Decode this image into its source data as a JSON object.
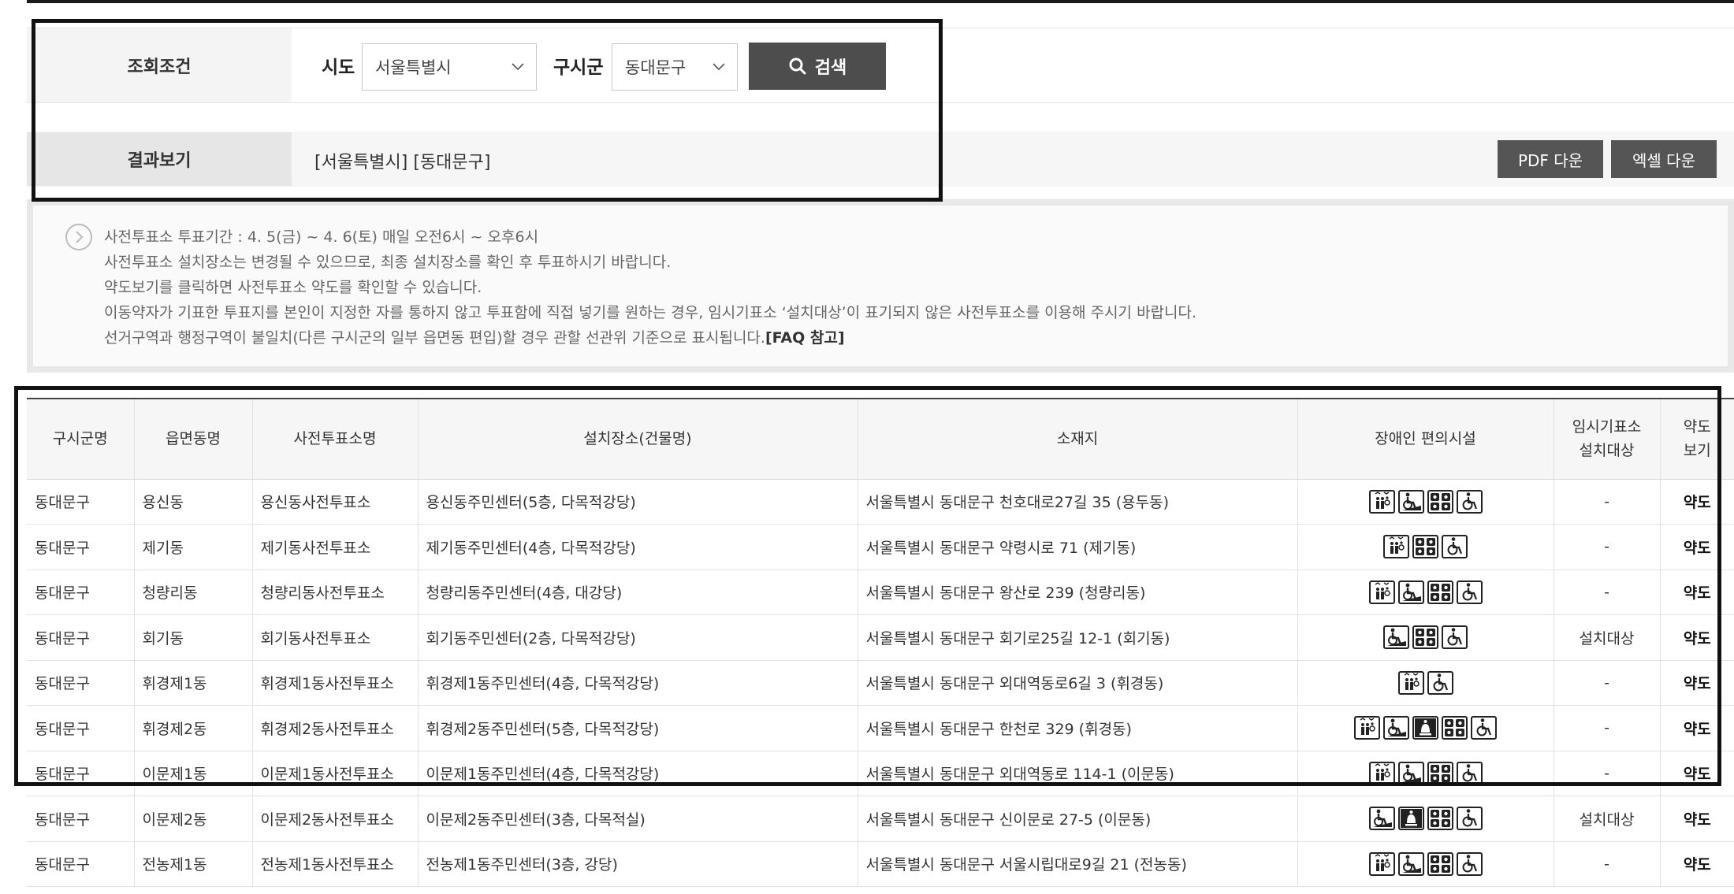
{
  "search": {
    "label": "조회조건",
    "sido_label": "시도",
    "sido_value": "서울특별시",
    "sigungu_label": "구시군",
    "sigungu_value": "동대문구",
    "button_label": "검색"
  },
  "result": {
    "label": "결과보기",
    "summary": "[서울특별시] [동대문구]",
    "pdf_label": "PDF 다운",
    "excel_label": "엑셀 다운"
  },
  "info": {
    "lines": [
      "사전투표소 투표기간 : 4. 5(금) ~ 4. 6(토) 매일 오전6시 ~ 오후6시",
      "사전투표소 설치장소는 변경될 수 있으므로, 최종 설치장소를 확인 후 투표하시기 바랍니다.",
      "약도보기를 클릭하면 사전투표소 약도를 확인할 수 있습니다.",
      "이동약자가 기표한 투표지를 본인이 지정한 자를 통하지 않고 투표함에 직접 넣기를 원하는 경우, 임시기표소 ‘설치대상’이 표기되지 않은 사전투표소를 이용해 주시기 바랍니다.",
      "선거구역과 행정구역이 불일치(다른 구시군의 일부 읍면동 편입)할 경우 관할 선관위 기준으로 표시됩니다."
    ],
    "faq_link": "[FAQ 참고]"
  },
  "table": {
    "headers": {
      "sigungu": "구시군명",
      "eupmyeondong": "읍면동명",
      "station": "사전투표소명",
      "place": "설치장소(건물명)",
      "address": "소재지",
      "facilities": "장애인 편의시설",
      "temp_booth_1": "임시기표소",
      "temp_booth_2": "설치대상",
      "map_1": "약도",
      "map_2": "보기"
    },
    "rows": [
      {
        "sigungu": "동대문구",
        "dong": "용신동",
        "station": "용신동사전투표소",
        "place": "용신동주민센터(5층, 다목적강당)",
        "address": "서울특별시 동대문구 천호대로27길 35 (용두동)",
        "icons": [
          "elevator-icon",
          "ramp-icon",
          "braille-icon",
          "wheelchair-icon"
        ],
        "temp": "-",
        "map": "약도"
      },
      {
        "sigungu": "동대문구",
        "dong": "제기동",
        "station": "제기동사전투표소",
        "place": "제기동주민센터(4층, 다목적강당)",
        "address": "서울특별시 동대문구 약령시로 71 (제기동)",
        "icons": [
          "elevator-icon",
          "braille-icon",
          "wheelchair-icon"
        ],
        "temp": "-",
        "map": "약도"
      },
      {
        "sigungu": "동대문구",
        "dong": "청량리동",
        "station": "청량리동사전투표소",
        "place": "청량리동주민센터(4층, 대강당)",
        "address": "서울특별시 동대문구 왕산로 239 (청량리동)",
        "icons": [
          "elevator-icon",
          "ramp-icon",
          "braille-icon",
          "wheelchair-icon"
        ],
        "temp": "-",
        "map": "약도"
      },
      {
        "sigungu": "동대문구",
        "dong": "회기동",
        "station": "회기동사전투표소",
        "place": "회기동주민센터(2층, 다목적강당)",
        "address": "서울특별시 동대문구 회기로25길 12-1 (회기동)",
        "icons": [
          "ramp-icon",
          "braille-icon",
          "wheelchair-icon"
        ],
        "temp": "설치대상",
        "map": "약도"
      },
      {
        "sigungu": "동대문구",
        "dong": "휘경제1동",
        "station": "휘경제1동사전투표소",
        "place": "휘경제1동주민센터(4층, 다목적강당)",
        "address": "서울특별시 동대문구 외대역동로6길 3 (휘경동)",
        "icons": [
          "elevator-icon",
          "wheelchair-icon"
        ],
        "temp": "-",
        "map": "약도"
      },
      {
        "sigungu": "동대문구",
        "dong": "휘경제2동",
        "station": "휘경제2동사전투표소",
        "place": "휘경제2동주민센터(5층, 다목적강당)",
        "address": "서울특별시 동대문구 한천로 329 (휘경동)",
        "icons": [
          "elevator-icon",
          "ramp-icon",
          "bell-icon",
          "braille-icon",
          "wheelchair-icon"
        ],
        "temp": "-",
        "map": "약도"
      },
      {
        "sigungu": "동대문구",
        "dong": "이문제1동",
        "station": "이문제1동사전투표소",
        "place": "이문제1동주민센터(4층, 다목적강당)",
        "address": "서울특별시 동대문구 외대역동로 114-1 (이문동)",
        "icons": [
          "elevator-icon",
          "ramp-icon",
          "braille-icon",
          "wheelchair-icon"
        ],
        "temp": "-",
        "map": "약도"
      },
      {
        "sigungu": "동대문구",
        "dong": "이문제2동",
        "station": "이문제2동사전투표소",
        "place": "이문제2동주민센터(3층, 다목적실)",
        "address": "서울특별시 동대문구 신이문로 27-5 (이문동)",
        "icons": [
          "ramp-icon",
          "bell-icon",
          "braille-icon",
          "wheelchair-icon"
        ],
        "temp": "설치대상",
        "map": "약도"
      },
      {
        "sigungu": "동대문구",
        "dong": "전농제1동",
        "station": "전농제1동사전투표소",
        "place": "전농제1동주민센터(3층, 강당)",
        "address": "서울특별시 동대문구 서울시립대로9길 21 (전농동)",
        "icons": [
          "elevator-icon",
          "ramp-icon",
          "braille-icon",
          "wheelchair-icon"
        ],
        "temp": "-",
        "map": "약도"
      }
    ]
  }
}
